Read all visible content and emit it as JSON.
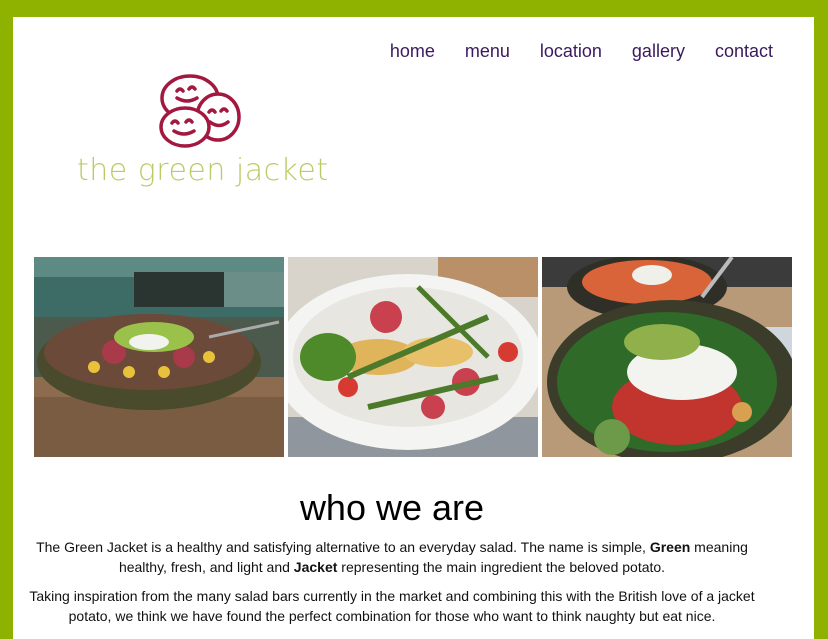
{
  "nav": {
    "items": [
      {
        "label": "home"
      },
      {
        "label": "menu"
      },
      {
        "label": "location"
      },
      {
        "label": "gallery"
      },
      {
        "label": "contact"
      }
    ]
  },
  "logo": {
    "text": "the green jacket"
  },
  "colors": {
    "frame": "#8fb200",
    "nav": "#3a1a5e",
    "logo_mark": "#a3183f",
    "logo_text": "#b8cc66"
  },
  "about": {
    "heading": "who we are",
    "p1": {
      "a": "The Green Jacket is a healthy and satisfying alternative to an everyday salad. The name is simple, ",
      "b": "Green",
      "c": " meaning healthy, fresh, and light and ",
      "d": "Jacket",
      "e": " representing the main ingredient the beloved potato."
    },
    "p2": "Taking inspiration from the many salad bars currently in the market and combining this with the British love of a jacket potato, we think we have found the perfect combination for those who want to think naughty but eat nice."
  }
}
